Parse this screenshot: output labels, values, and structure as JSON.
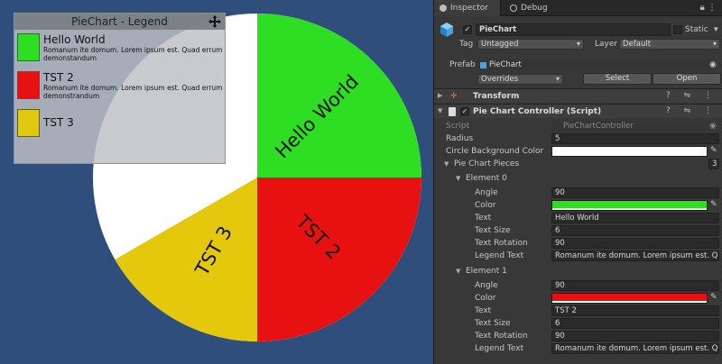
{
  "legend": {
    "title": "PieChart - Legend",
    "items": [
      {
        "name": "Hello World",
        "desc": "Romanum ite domum. Lorem ipsum est. Quad errum demonstandum",
        "color": "#2ede22"
      },
      {
        "name": "TST 2",
        "desc": "Romanum ite domum. Lorem ipsum est. Quad errum demonstrandum",
        "color": "#e81111"
      },
      {
        "name": "TST 3",
        "desc": "",
        "color": "#dfc80e"
      }
    ]
  },
  "pie": {
    "background_color": "#ffffff",
    "slices": [
      {
        "label": "Hello World",
        "angle": 90,
        "color": "#2ede22"
      },
      {
        "label": "TST 2",
        "angle": 90,
        "color": "#e81111"
      },
      {
        "label": "TST 3",
        "angle": 60,
        "color": "#e3c80c"
      }
    ]
  },
  "inspector": {
    "tabs": {
      "inspector": "Inspector",
      "debug": "Debug"
    },
    "object_name": "PieChart",
    "static_label": "Static",
    "tag_label": "Tag",
    "tag_value": "Untagged",
    "layer_label": "Layer",
    "layer_value": "Default",
    "prefab_label": "Prefab",
    "prefab_value": "PieChart",
    "overrides_label": "Overrides",
    "select_label": "Select",
    "open_label": "Open",
    "transform_label": "Transform",
    "component_label": "Pie Chart Controller (Script)",
    "script_label": "Script",
    "script_value": "PieChartController",
    "radius_label": "Radius",
    "radius_value": "5",
    "circle_bg_label": "Circle Background Color",
    "pieces_label": "Pie Chart Pieces",
    "pieces_count": "3",
    "elements": [
      {
        "title": "Element 0",
        "angle_label": "Angle",
        "angle": "90",
        "color_label": "Color",
        "color": "#2ede22",
        "text_label": "Text",
        "text": "Hello World",
        "text_size_label": "Text Size",
        "text_size": "6",
        "text_rotation_label": "Text Rotation",
        "text_rotation": "90",
        "legend_text_label": "Legend Text",
        "legend_text": "Romanum ite domum. Lorem ipsum est. Quad"
      },
      {
        "title": "Element 1",
        "angle_label": "Angle",
        "angle": "90",
        "color_label": "Color",
        "color": "#e81111",
        "text_label": "Text",
        "text": "TST 2",
        "text_size_label": "Text Size",
        "text_size": "6",
        "text_rotation_label": "Text Rotation",
        "text_rotation": "90",
        "legend_text_label": "Legend Text",
        "legend_text": "Romanum ite domum. Lorem ipsum est. Quad"
      }
    ]
  }
}
